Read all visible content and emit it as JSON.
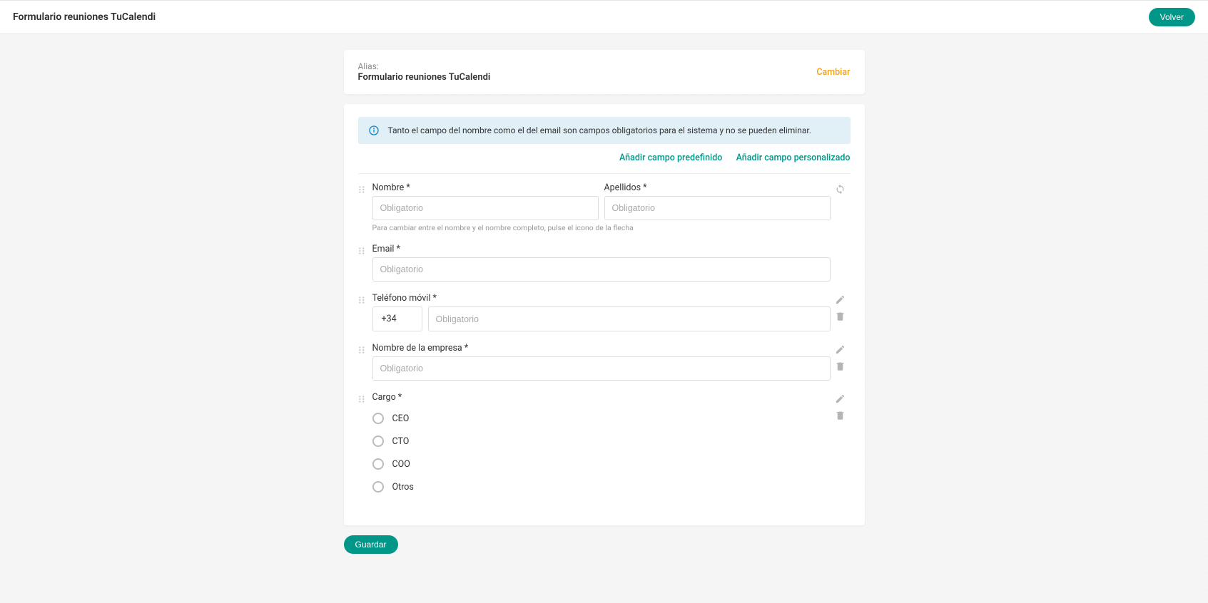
{
  "header": {
    "title": "Formulario reuniones TuCalendi",
    "back_button": "Volver"
  },
  "alias": {
    "label": "Alias:",
    "value": "Formulario reuniones TuCalendi",
    "change": "Cambiar"
  },
  "info_banner": "Tanto el campo del nombre como el del email son campos obligatorios para el sistema y no se pueden eliminar.",
  "actions": {
    "add_predefined": "Añadir campo predefinido",
    "add_custom": "Añadir campo personalizado"
  },
  "fields": {
    "name": {
      "label": "Nombre *",
      "placeholder": "Obligatorio",
      "surname_label": "Apellidos *",
      "surname_placeholder": "Obligatorio",
      "hint": "Para cambiar entre el nombre y el nombre completo, pulse el icono de la flecha"
    },
    "email": {
      "label": "Email *",
      "placeholder": "Obligatorio"
    },
    "phone": {
      "label": "Teléfono móvil *",
      "prefix": "+34",
      "placeholder": "Obligatorio"
    },
    "company": {
      "label": "Nombre de la empresa *",
      "placeholder": "Obligatorio"
    },
    "role": {
      "label": "Cargo *",
      "options": [
        "CEO",
        "CTO",
        "COO",
        "Otros"
      ]
    }
  },
  "save": "Guardar"
}
